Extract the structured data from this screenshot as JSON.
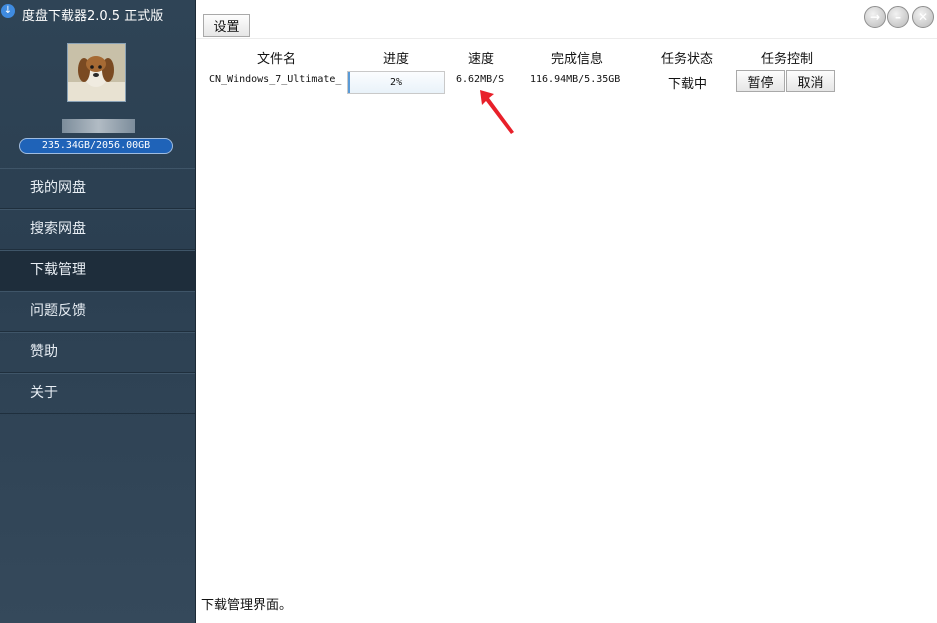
{
  "app": {
    "title": "度盘下载器2.0.5 正式版",
    "icon": "download-icon"
  },
  "user": {
    "quota": "235.34GB/2056.00GB"
  },
  "nav": {
    "items": [
      {
        "label": "我的网盘",
        "active": false
      },
      {
        "label": "搜索网盘",
        "active": false
      },
      {
        "label": "下载管理",
        "active": true
      },
      {
        "label": "问题反馈",
        "active": false
      },
      {
        "label": "赞助",
        "active": false
      },
      {
        "label": "关于",
        "active": false
      }
    ]
  },
  "toolbar": {
    "settings_label": "设置"
  },
  "table": {
    "headers": [
      "文件名",
      "进度",
      "速度",
      "完成信息",
      "任务状态",
      "任务控制"
    ],
    "rows": [
      {
        "filename": "CN_Windows_7_Ultimate_",
        "progress": "2%",
        "progress_value": 0.02,
        "speed": "6.62MB/S",
        "done_info": "116.94MB/5.35GB",
        "status": "下载中",
        "pause_label": "暂停",
        "cancel_label": "取消"
      }
    ]
  },
  "status_bar": {
    "text": "下载管理界面。"
  },
  "colors": {
    "sidebar_bg": "#2f4456",
    "nav_active": "#1e2d3b",
    "quota_bar": "#1f63b8",
    "arrow": "#e8202a"
  }
}
